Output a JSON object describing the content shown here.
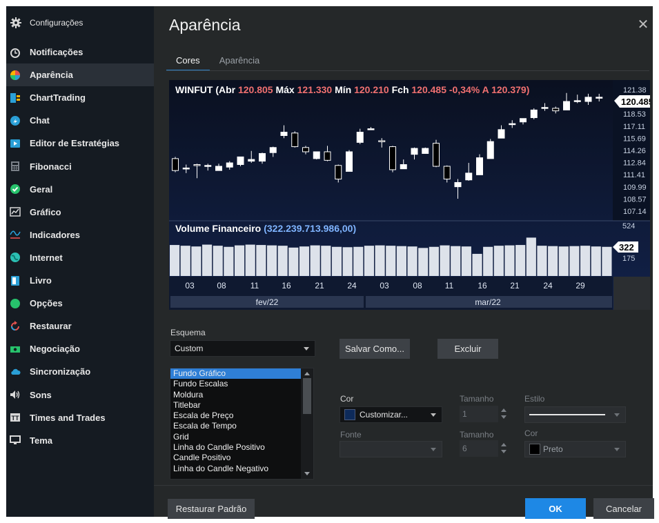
{
  "sidebar": {
    "header": {
      "label": "Configurações",
      "icon": "gear-icon"
    },
    "items": [
      {
        "label": "Notificações",
        "icon": "alarm-clock-icon",
        "color": "#d8d8d8"
      },
      {
        "label": "Aparência",
        "icon": "palette-icon",
        "color": "#e3524f",
        "active": true
      },
      {
        "label": "ChartTrading",
        "icon": "chart-trading-icon",
        "color": "#2a9fd6"
      },
      {
        "label": "Chat",
        "icon": "chat-icon",
        "color": "#2a9fd6"
      },
      {
        "label": "Editor de Estratégias",
        "icon": "strategy-editor-icon",
        "color": "#2a9fd6"
      },
      {
        "label": "Fibonacci",
        "icon": "calculator-icon",
        "color": "#7a8088"
      },
      {
        "label": "Geral",
        "icon": "check-circle-icon",
        "color": "#27c26c"
      },
      {
        "label": "Gráfico",
        "icon": "line-chart-icon",
        "color": "#d8d8d8"
      },
      {
        "label": "Indicadores",
        "icon": "indicators-icon",
        "color": "#2a9fd6"
      },
      {
        "label": "Internet",
        "icon": "globe-icon",
        "color": "#2bbfb3"
      },
      {
        "label": "Livro",
        "icon": "book-icon",
        "color": "#2a9fd6"
      },
      {
        "label": "Opções",
        "icon": "options-icon",
        "color": "#27c26c"
      },
      {
        "label": "Restaurar",
        "icon": "restore-icon",
        "color": "#e3524f"
      },
      {
        "label": "Negociação",
        "icon": "money-icon",
        "color": "#27c26c"
      },
      {
        "label": "Sincronização",
        "icon": "cloud-icon",
        "color": "#2a9fd6"
      },
      {
        "label": "Sons",
        "icon": "speaker-icon",
        "color": "#d8d8d8"
      },
      {
        "label": "Times and Trades",
        "icon": "times-trades-icon",
        "color": "#d8d8d8"
      },
      {
        "label": "Tema",
        "icon": "monitor-icon",
        "color": "#d8d8d8"
      }
    ]
  },
  "dialog": {
    "title": "Aparência",
    "close_icon": "close-icon",
    "tabs": [
      {
        "label": "Cores",
        "active": true
      },
      {
        "label": "Aparência",
        "active": false
      }
    ]
  },
  "preview": {
    "header_symbol": "WINFUT",
    "header_parts": [
      {
        "text": "WINFUT (Abr ",
        "color": "#ffffff"
      },
      {
        "text": "120.805",
        "color": "#f07070"
      },
      {
        "text": " Máx ",
        "color": "#ffffff"
      },
      {
        "text": "121.330",
        "color": "#f07070"
      },
      {
        "text": " Mín ",
        "color": "#ffffff"
      },
      {
        "text": "120.210",
        "color": "#f07070"
      },
      {
        "text": " Fch ",
        "color": "#ffffff"
      },
      {
        "text": "120.485",
        "color": "#f07070"
      },
      {
        "text": "  -0,34%",
        "color": "#f07070"
      },
      {
        "text": "  A ",
        "color": "#f07070"
      },
      {
        "text": "120.379)",
        "color": "#f07070"
      }
    ],
    "price_ticks": [
      "121.38",
      "119.96",
      "118.53",
      "117.11",
      "115.69",
      "114.26",
      "112.84",
      "111.41",
      "109.99",
      "108.57",
      "107.14"
    ],
    "last_price": "120.485",
    "volume_label": "Volume Financeiro",
    "volume_value": "(322.239.713.986,00)",
    "volume_ticks": [
      "524",
      "322",
      "175"
    ],
    "volume_badge": "322",
    "date_ticks": [
      "03",
      "08",
      "11",
      "16",
      "21",
      "24",
      "03",
      "08",
      "11",
      "16",
      "21",
      "24",
      "29"
    ],
    "months": [
      "fev/22",
      "mar/22"
    ],
    "colors": {
      "background": "#0d1425",
      "candle_up": "#ffffff",
      "candle_down": "#000000",
      "volume_bar": "#dde2ea",
      "header_value": "#f07070",
      "volume_value": "#7fb4ff"
    }
  },
  "chart_data": {
    "type": "candlestick",
    "candles": [
      {
        "o": 113.3,
        "h": 113.5,
        "l": 111.7,
        "c": 111.9
      },
      {
        "o": 112.1,
        "h": 112.6,
        "l": 111.6,
        "c": 112.2
      },
      {
        "o": 112.6,
        "h": 112.7,
        "l": 111.0,
        "c": 112.5
      },
      {
        "o": 112.5,
        "h": 112.7,
        "l": 111.9,
        "c": 112.5
      },
      {
        "o": 111.9,
        "h": 112.7,
        "l": 111.9,
        "c": 112.4
      },
      {
        "o": 112.3,
        "h": 113.0,
        "l": 112.0,
        "c": 112.8
      },
      {
        "o": 112.6,
        "h": 113.5,
        "l": 112.4,
        "c": 113.5
      },
      {
        "o": 113.0,
        "h": 114.2,
        "l": 112.8,
        "c": 113.2
      },
      {
        "o": 113.0,
        "h": 114.0,
        "l": 112.7,
        "c": 113.9
      },
      {
        "o": 114.0,
        "h": 114.7,
        "l": 113.5,
        "c": 114.6
      },
      {
        "o": 116.0,
        "h": 117.2,
        "l": 115.7,
        "c": 116.4
      },
      {
        "o": 116.3,
        "h": 116.5,
        "l": 114.6,
        "c": 114.7
      },
      {
        "o": 114.6,
        "h": 114.8,
        "l": 113.8,
        "c": 114.1
      },
      {
        "o": 113.3,
        "h": 114.1,
        "l": 113.2,
        "c": 114.1
      },
      {
        "o": 114.1,
        "h": 114.8,
        "l": 113.0,
        "c": 113.1
      },
      {
        "o": 112.5,
        "h": 112.6,
        "l": 110.5,
        "c": 110.9
      },
      {
        "o": 111.8,
        "h": 114.3,
        "l": 111.8,
        "c": 114.1
      },
      {
        "o": 115.2,
        "h": 116.8,
        "l": 115.0,
        "c": 116.4
      },
      {
        "o": 116.8,
        "h": 117.0,
        "l": 116.8,
        "c": 116.8
      },
      {
        "o": 115.4,
        "h": 115.7,
        "l": 114.6,
        "c": 115.3
      },
      {
        "o": 114.7,
        "h": 114.8,
        "l": 111.7,
        "c": 112.0
      },
      {
        "o": 112.1,
        "h": 113.2,
        "l": 112.1,
        "c": 112.6
      },
      {
        "o": 113.8,
        "h": 114.6,
        "l": 113.2,
        "c": 114.5
      },
      {
        "o": 113.9,
        "h": 114.6,
        "l": 113.9,
        "c": 114.5
      },
      {
        "o": 115.1,
        "h": 115.5,
        "l": 112.3,
        "c": 112.4
      },
      {
        "o": 112.4,
        "h": 112.5,
        "l": 110.5,
        "c": 110.9
      },
      {
        "o": 110.0,
        "h": 110.9,
        "l": 108.6,
        "c": 110.5
      },
      {
        "o": 110.8,
        "h": 112.8,
        "l": 110.7,
        "c": 111.6
      },
      {
        "o": 111.4,
        "h": 113.8,
        "l": 111.4,
        "c": 113.4
      },
      {
        "o": 113.3,
        "h": 115.6,
        "l": 113.3,
        "c": 115.3
      },
      {
        "o": 115.7,
        "h": 117.2,
        "l": 115.7,
        "c": 116.7
      },
      {
        "o": 117.4,
        "h": 117.8,
        "l": 116.9,
        "c": 117.4
      },
      {
        "o": 117.6,
        "h": 118.0,
        "l": 117.3,
        "c": 118.0
      },
      {
        "o": 118.1,
        "h": 119.2,
        "l": 117.9,
        "c": 119.0
      },
      {
        "o": 119.3,
        "h": 119.8,
        "l": 118.9,
        "c": 119.3
      },
      {
        "o": 119.2,
        "h": 119.4,
        "l": 118.6,
        "c": 118.9
      },
      {
        "o": 119.0,
        "h": 121.0,
        "l": 119.0,
        "c": 120.0
      },
      {
        "o": 120.1,
        "h": 120.8,
        "l": 119.8,
        "c": 120.1
      },
      {
        "o": 120.0,
        "h": 120.9,
        "l": 119.6,
        "c": 120.5
      },
      {
        "o": 120.5,
        "h": 120.9,
        "l": 120.0,
        "c": 120.5
      }
    ],
    "volume": [
      420,
      410,
      400,
      425,
      410,
      395,
      415,
      425,
      420,
      415,
      410,
      385,
      400,
      415,
      410,
      395,
      390,
      395,
      410,
      415,
      410,
      405,
      400,
      380,
      395,
      415,
      405,
      400,
      300,
      395,
      410,
      415,
      420,
      520,
      410,
      405,
      400,
      405,
      410,
      400,
      395
    ],
    "price_ticks": [
      121.38,
      119.96,
      118.53,
      117.11,
      115.69,
      114.26,
      112.84,
      111.41,
      109.99,
      108.57,
      107.14
    ],
    "volume_ticks": [
      524,
      322,
      175
    ]
  },
  "form": {
    "scheme_label": "Esquema",
    "scheme_value": "Custom",
    "save_as_label": "Salvar Como...",
    "delete_label": "Excluir",
    "elements": [
      "Fundo Gráfico",
      "Fundo Escalas",
      "Moldura",
      "Titlebar",
      "Escala de Preço",
      "Escala de Tempo",
      "Grid",
      "Linha do Candle Positivo",
      "Candle Positivo",
      "Linha do Candle Negativo"
    ],
    "selected_element": "Fundo Gráfico",
    "cor_label": "Cor",
    "cor_value": "Customizar...",
    "cor_swatch": "#0d2a5a",
    "tamanho_label": "Tamanho",
    "tamanho_value": "1",
    "estilo_label": "Estilo",
    "fonte_label": "Fonte",
    "fonte_value": "",
    "tamanho2_label": "Tamanho",
    "tamanho2_value": "6",
    "cor2_label": "Cor",
    "cor2_value": "Preto",
    "cor2_swatch": "#000000"
  },
  "footer": {
    "restore_label": "Restaurar Padrão",
    "ok_label": "OK",
    "cancel_label": "Cancelar"
  }
}
